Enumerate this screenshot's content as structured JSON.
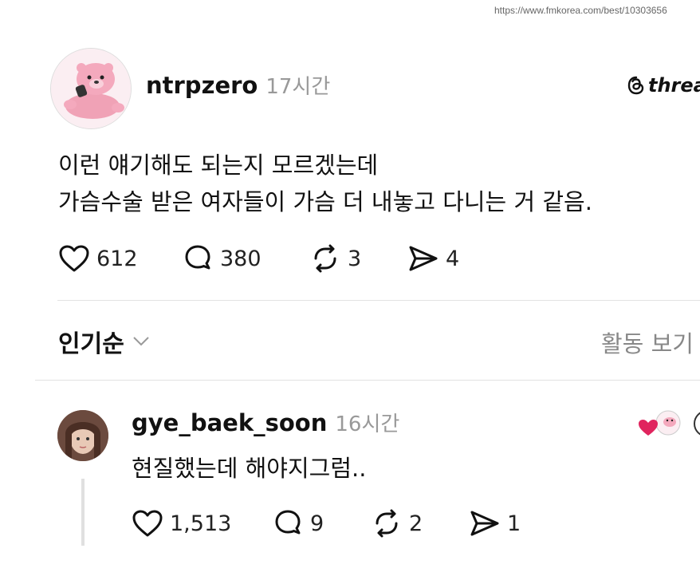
{
  "url": "https://www.fmkorea.com/best/10303656",
  "post": {
    "author": "ntrpzero",
    "time": "17시간",
    "brand": "threa",
    "text_line1": "이런 얘기해도 되는지 모르겠는데",
    "text_line2": "가슴수술 받은 여자들이 가슴 더 내놓고 다니는 거 같음.",
    "likes": "612",
    "replies": "380",
    "reposts": "3",
    "shares": "4"
  },
  "sort": {
    "label": "인기순",
    "activity": "활동 보기"
  },
  "comment": {
    "author": "gye_baek_soon",
    "time": "16시간",
    "text": "현질했는데 해야지그럼..",
    "likes": "1,513",
    "replies": "9",
    "reposts": "2",
    "shares": "1"
  },
  "colors": {
    "text": "#111111",
    "muted": "#999999",
    "divider": "#e2e2e2",
    "heart": "#e0245e"
  }
}
